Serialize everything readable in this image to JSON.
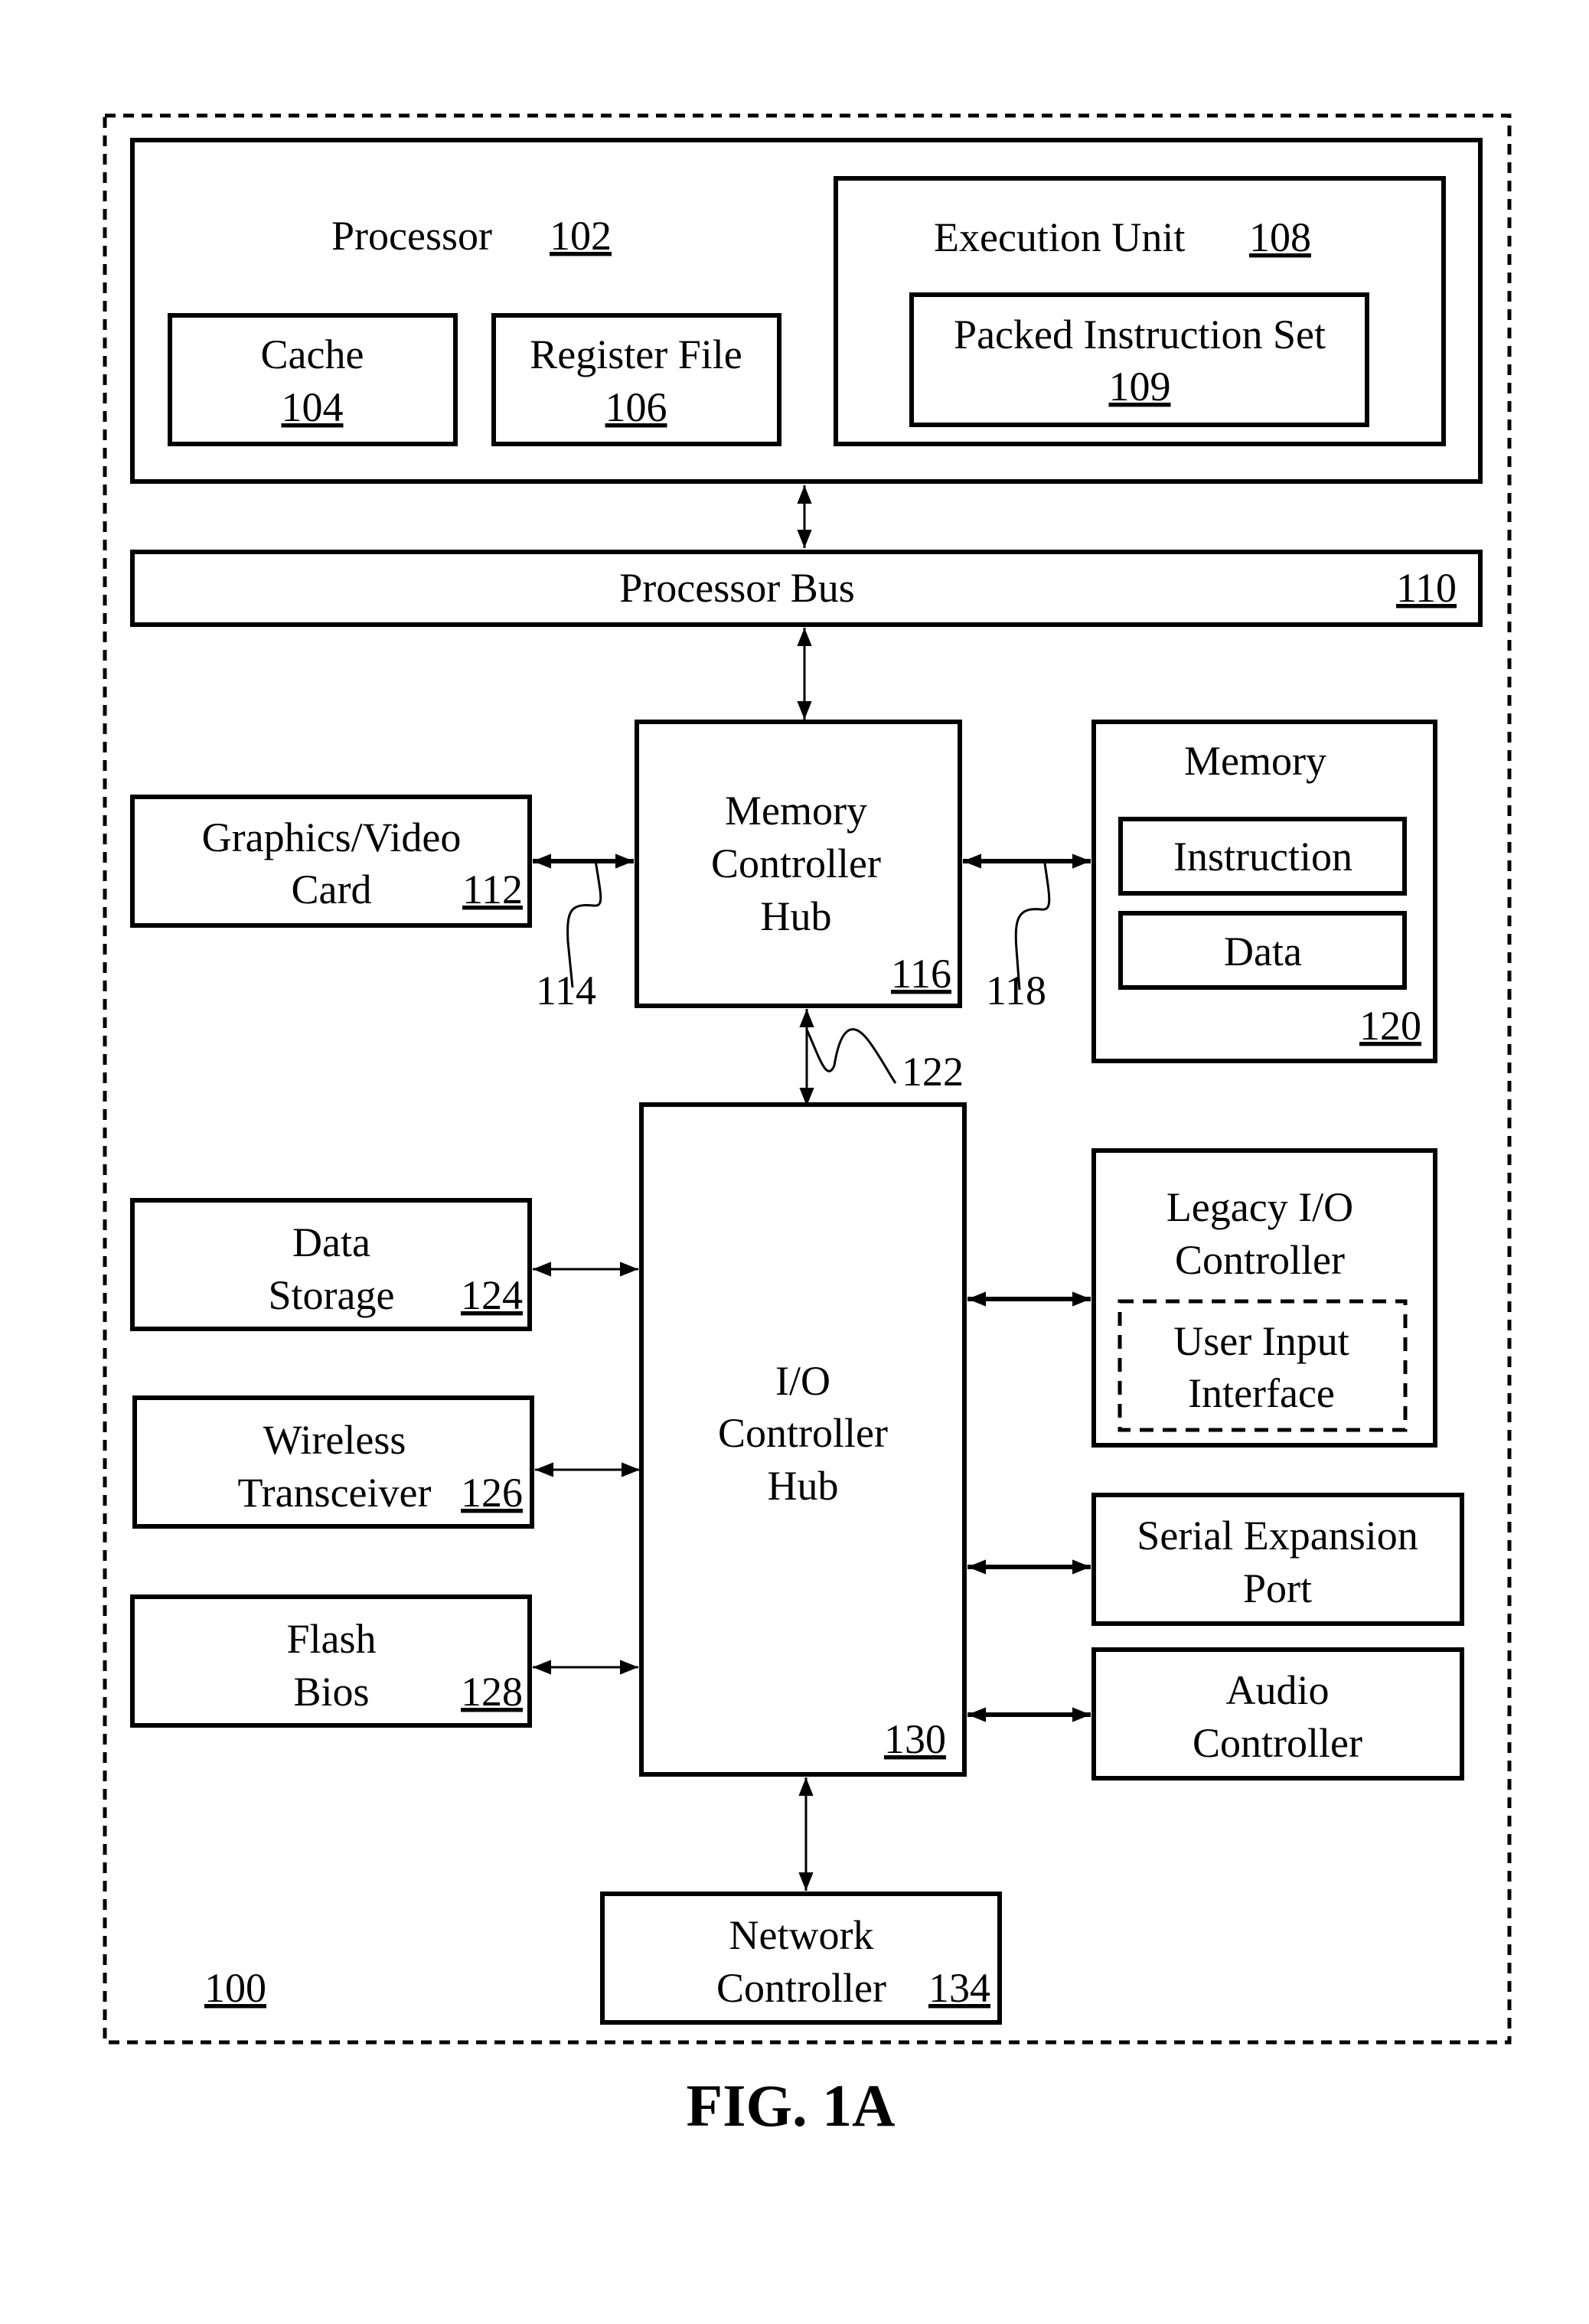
{
  "figure": {
    "caption": "FIG. 1A",
    "system_ref": "100"
  },
  "processor": {
    "label": "Processor",
    "ref": "102",
    "cache": {
      "label": "Cache",
      "ref": "104"
    },
    "register_file": {
      "label": "Register File",
      "ref": "106"
    },
    "execution_unit": {
      "label": "Execution Unit",
      "ref": "108",
      "packed_instruction_set": {
        "label": "Packed Instruction Set",
        "ref": "109"
      }
    }
  },
  "processor_bus": {
    "label": "Processor Bus",
    "ref": "110"
  },
  "graphics_card": {
    "line1": "Graphics/Video",
    "line2": "Card",
    "ref": "112"
  },
  "memory_controller_hub": {
    "line1": "Memory",
    "line2": "Controller",
    "line3": "Hub",
    "ref": "116"
  },
  "memory": {
    "label": "Memory",
    "ref": "120",
    "instruction": "Instruction",
    "data": "Data"
  },
  "callouts": {
    "c114": "114",
    "c118": "118",
    "c122": "122"
  },
  "io_controller_hub": {
    "line1": "I/O",
    "line2": "Controller",
    "line3": "Hub",
    "ref": "130"
  },
  "data_storage": {
    "line1": "Data",
    "line2": "Storage",
    "ref": "124"
  },
  "wireless_transceiver": {
    "line1": "Wireless",
    "line2": "Transceiver",
    "ref": "126"
  },
  "flash_bios": {
    "line1": "Flash",
    "line2": "Bios",
    "ref": "128"
  },
  "legacy_io_controller": {
    "line1": "Legacy I/O",
    "line2": "Controller",
    "user_input": {
      "line1": "User Input",
      "line2": "Interface"
    }
  },
  "serial_expansion_port": {
    "line1": "Serial Expansion",
    "line2": "Port"
  },
  "audio_controller": {
    "line1": "Audio",
    "line2": "Controller"
  },
  "network_controller": {
    "line1": "Network",
    "line2": "Controller",
    "ref": "134"
  }
}
